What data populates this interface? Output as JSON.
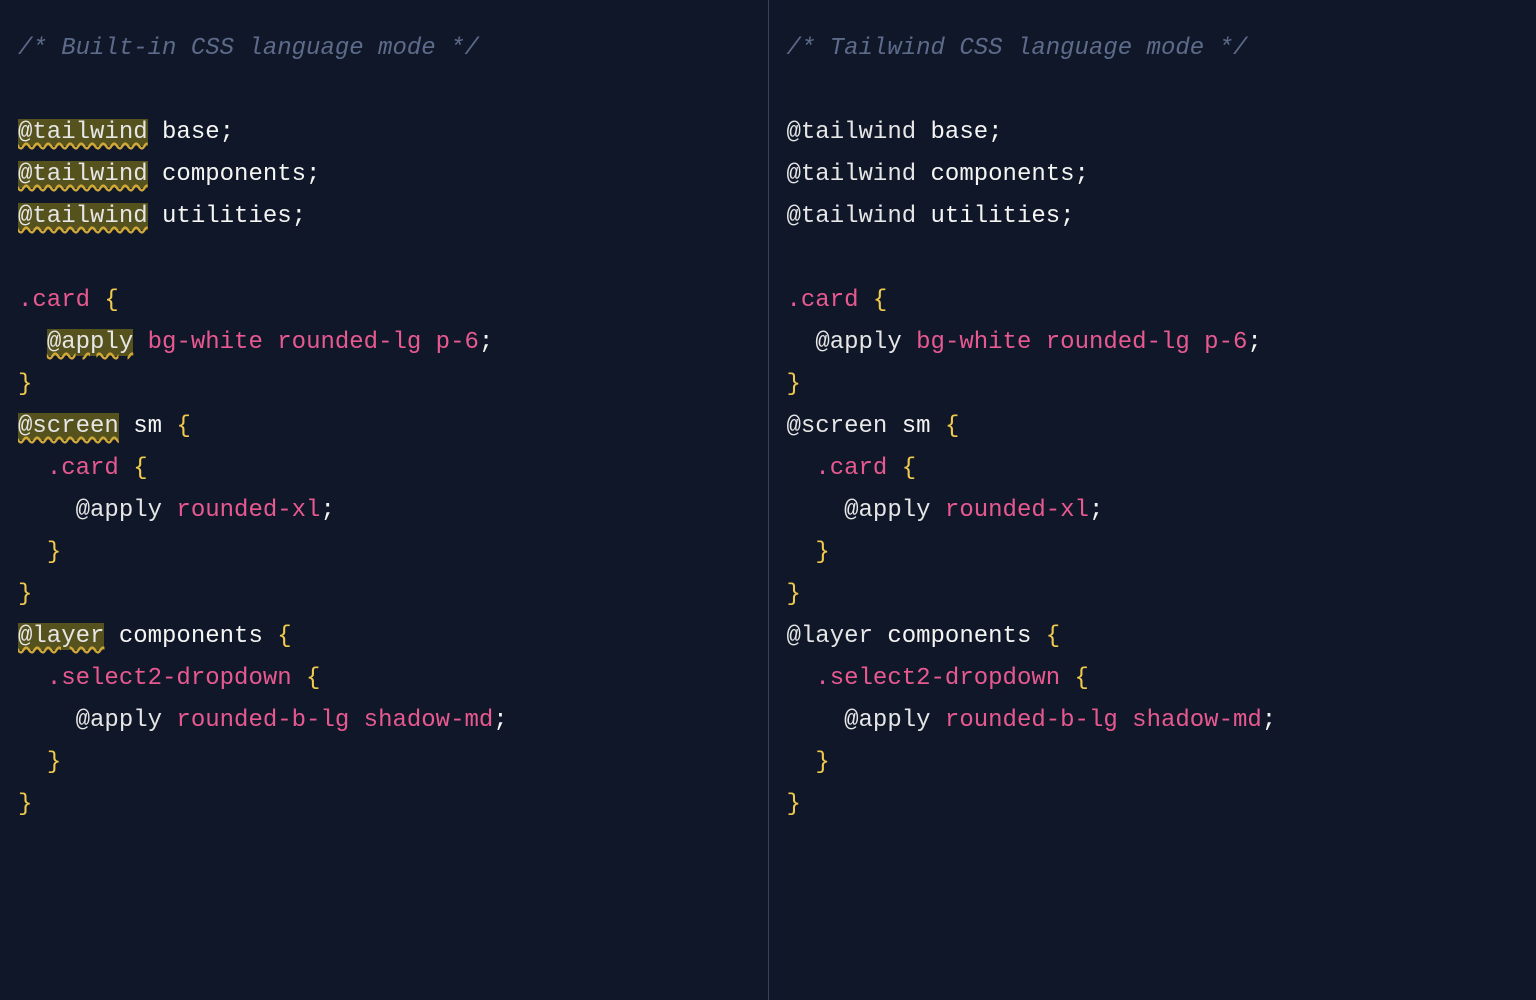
{
  "left": {
    "comment": "/* Built-in CSS language mode */",
    "tailwindAt": "@tailwind",
    "base": " base;",
    "components": " components;",
    "utilities": " utilities;",
    "card": ".card",
    "open": " {",
    "applyAt": "@apply",
    "applyCardUtils": " bg-white rounded-lg p-6",
    "semi": ";",
    "close": "}",
    "screenAt": "@screen",
    "screenArg": " sm ",
    "roundedXl": " rounded-xl",
    "layerAt": "@layer",
    "layerArg": " components ",
    "select2": ".select2-dropdown",
    "roundedBShadow": " rounded-b-lg shadow-md",
    "indent1": "  ",
    "indent2": "    "
  },
  "right": {
    "comment": "/* Tailwind CSS language mode */",
    "tailwindAt": "@tailwind",
    "base": " base;",
    "components": " components;",
    "utilities": " utilities;",
    "card": ".card",
    "open": " {",
    "applyAt": "@apply",
    "applyCardUtils": " bg-white rounded-lg p-6",
    "semi": ";",
    "close": "}",
    "screenAt": "@screen",
    "screenArg": " sm ",
    "roundedXl": " rounded-xl",
    "layerAt": "@layer",
    "layerArg": " components ",
    "select2": ".select2-dropdown",
    "roundedBShadow": " rounded-b-lg shadow-md",
    "indent1": "  ",
    "indent2": "    "
  }
}
